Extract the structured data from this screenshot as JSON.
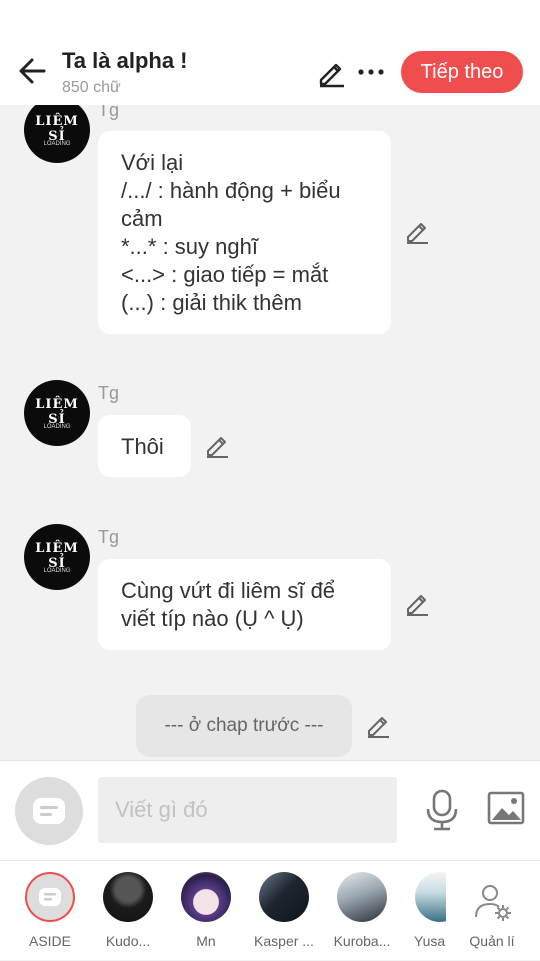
{
  "header": {
    "title": "Ta là alpha !",
    "word_count": "850 chữ",
    "next_label": "Tiếp theo",
    "accent": "#f04e4e"
  },
  "messages": [
    {
      "sender": "Tg",
      "avatar": {
        "line1": "LIÊM SỈ",
        "line2": "◌",
        "line3": "LOADING"
      },
      "lines": [
        "Với lại",
        "/.../ : hành động + biểu",
        "cảm",
        "*...* : suy nghĩ",
        "<...> : giao tiếp = mắt",
        "(...) : giải thik thêm"
      ]
    },
    {
      "sender": "Tg",
      "avatar": {
        "line1": "LIÊM SỈ",
        "line2": "◌",
        "line3": "LOADING"
      },
      "lines": [
        "Thôi"
      ]
    },
    {
      "sender": "Tg",
      "avatar": {
        "line1": "LIÊM SỈ",
        "line2": "◌",
        "line3": "LOADING"
      },
      "lines": [
        "Cùng vứt đi liêm sĩ để",
        "viết típ nào (Ụ ^ Ụ)"
      ]
    }
  ],
  "chapter_note": "--- ở chap trước ---",
  "composer": {
    "placeholder": "Viết gì đó"
  },
  "tabs": [
    {
      "label": "ASIDE"
    },
    {
      "label": "Kudo..."
    },
    {
      "label": "Mn"
    },
    {
      "label": "Kasper ..."
    },
    {
      "label": "Kuroba..."
    },
    {
      "label": "Yusa"
    },
    {
      "label": "Quản lí"
    }
  ]
}
